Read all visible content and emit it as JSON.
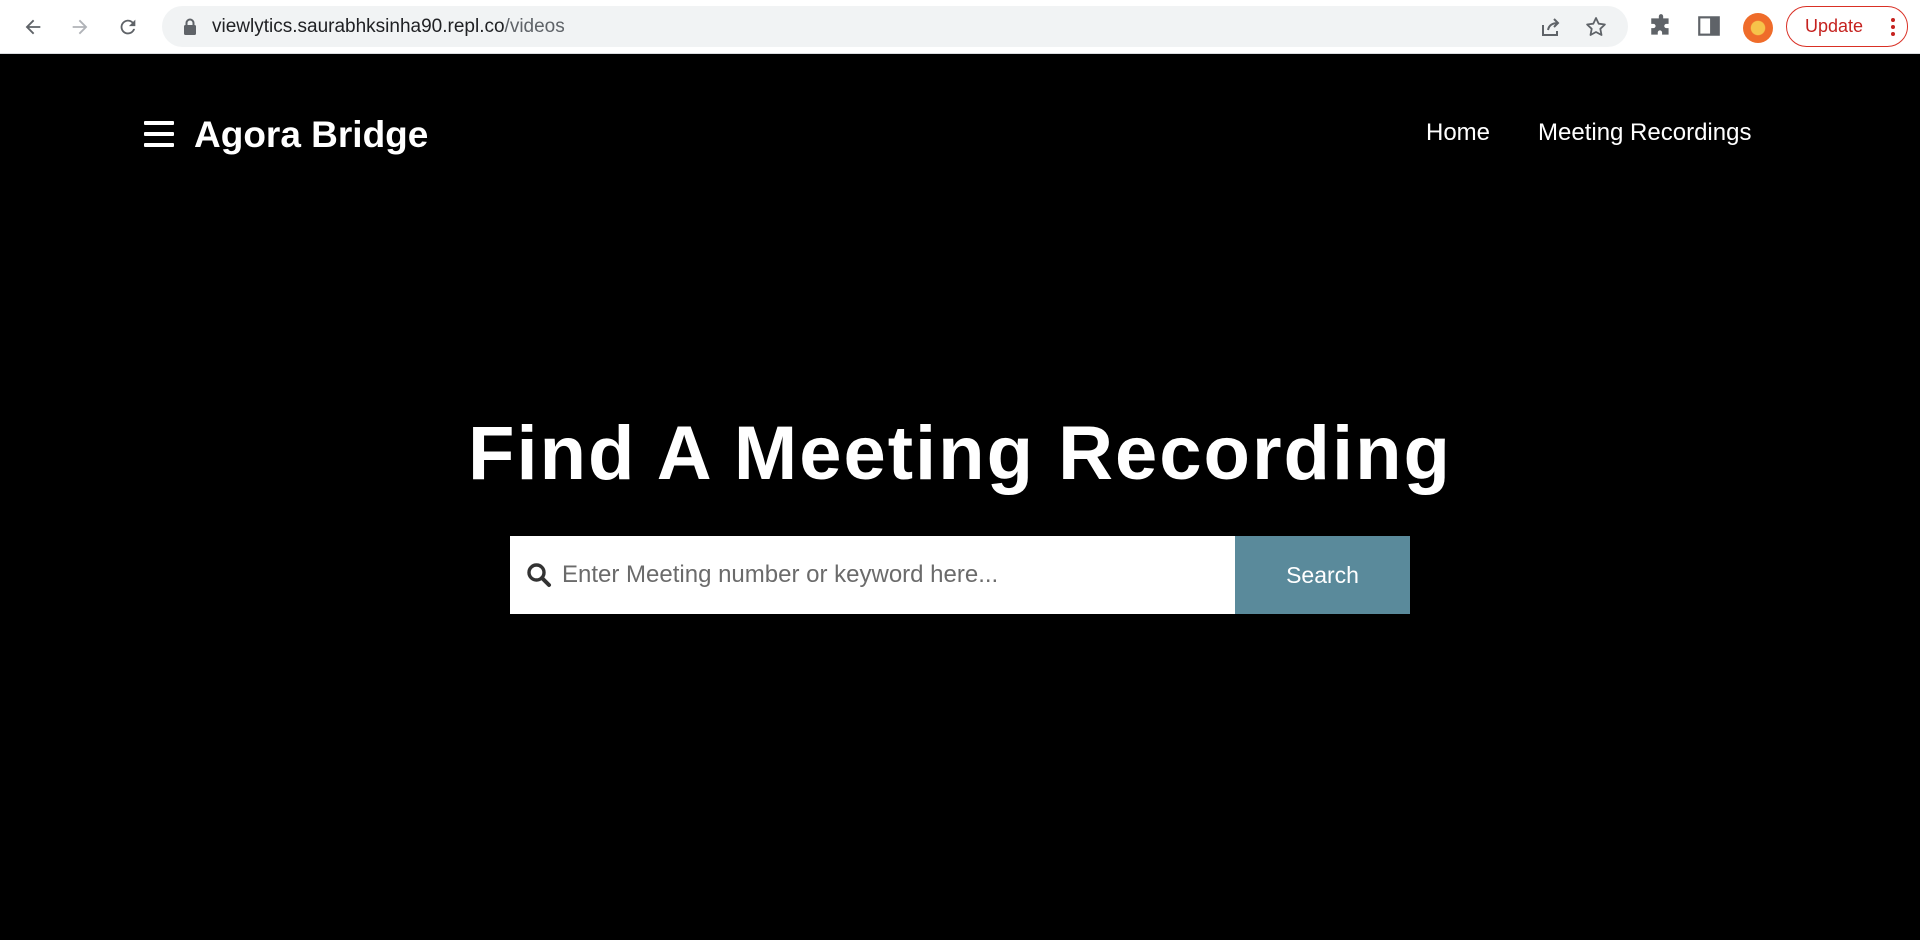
{
  "browser": {
    "url_host": "viewlytics.saurabhksinha90.repl.co",
    "url_path": "/videos",
    "update_label": "Update"
  },
  "header": {
    "brand": "Agora Bridge",
    "nav": [
      {
        "label": "Home"
      },
      {
        "label": "Meeting Recordings"
      }
    ]
  },
  "hero": {
    "title": "Find A Meeting Recording",
    "search": {
      "placeholder": "Enter Meeting number or keyword here...",
      "value": "",
      "button_label": "Search"
    }
  },
  "colors": {
    "page_background": "#000000",
    "search_button": "#5a8a9b",
    "update_accent": "#d93025"
  }
}
